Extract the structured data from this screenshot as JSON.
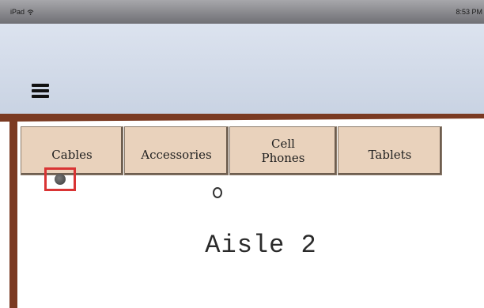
{
  "status_bar": {
    "device": "iPad",
    "time": "8:53 PM"
  },
  "nav": {
    "menu_icon": "hamburger-menu-icon"
  },
  "tabs": [
    {
      "label": "Cables",
      "selected": true
    },
    {
      "label": "Accessories",
      "selected": false
    },
    {
      "label": "Cell\nPhones",
      "selected": false
    },
    {
      "label": "Tablets",
      "selected": false
    }
  ],
  "map": {
    "aisle_label": "Aisle 2",
    "location_icon": "current-location-dot-icon",
    "highlight_color": "#d93434"
  },
  "colors": {
    "frame": "#7b3a22",
    "tab_bg": "#e9d2bc",
    "nav_bg": "#dce3ef"
  }
}
